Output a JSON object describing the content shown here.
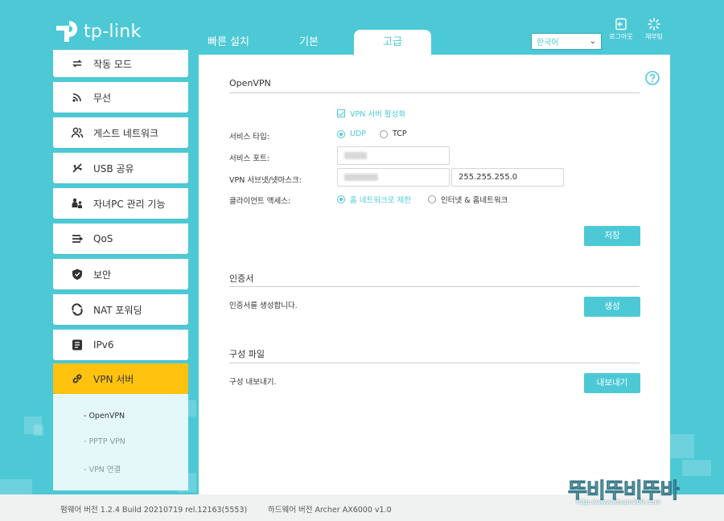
{
  "brand": {
    "name": "tp-link"
  },
  "tabs": [
    {
      "label": "빠른 설치"
    },
    {
      "label": "기본"
    },
    {
      "label": "고급"
    }
  ],
  "header": {
    "language": "한국어",
    "logout_label": "로그아웃",
    "reboot_label": "재부팅"
  },
  "sidebar": {
    "items": [
      {
        "label": "작동 모드",
        "icon": "operation-mode-icon"
      },
      {
        "label": "무선",
        "icon": "wireless-icon"
      },
      {
        "label": "게스트 네트워크",
        "icon": "guest-network-icon"
      },
      {
        "label": "USB 공유",
        "icon": "usb-icon"
      },
      {
        "label": "자녀PC 관리 기능",
        "icon": "parental-controls-icon"
      },
      {
        "label": "QoS",
        "icon": "qos-icon"
      },
      {
        "label": "보안",
        "icon": "shield-icon"
      },
      {
        "label": "NAT 포워딩",
        "icon": "nat-forwarding-icon"
      },
      {
        "label": "IPv6",
        "icon": "ipv6-icon"
      },
      {
        "label": "VPN 서버",
        "icon": "link-icon"
      }
    ],
    "submenu": [
      {
        "label": "- OpenVPN"
      },
      {
        "label": "- PPTP VPN"
      },
      {
        "label": "- VPN 연결"
      }
    ]
  },
  "openvpn": {
    "title": "OpenVPN",
    "enable_label": "VPN 서버 활성화",
    "enable_checked": true,
    "service_type_label": "서비스 타입:",
    "udp_label": "UDP",
    "tcp_label": "TCP",
    "service_type_selected": "UDP",
    "port_label": "서비스 포트:",
    "subnet_label": "VPN 서브넷/넷마스크:",
    "netmask_value": "255.255.255.0",
    "client_access_label": "클라이언트 액세스:",
    "home_network_label": "홈 네트워크로 제한",
    "internet_home_label": "인터넷 & 홈네트워크",
    "client_access_selected": "홈 네트워크로 제한",
    "save_label": "저장"
  },
  "certificate": {
    "title": "인증서",
    "description": "인증서를 생성합니다.",
    "generate_label": "생성"
  },
  "config_file": {
    "title": "구성 파일",
    "description": "구성 내보내기.",
    "export_label": "내보내기"
  },
  "footer": {
    "firmware": "펌웨어 버전 1.2.4 Build 20210719 rel.12163(5553)",
    "hardware": "하드웨어 버전 Archer AX6000 v1.0"
  },
  "colors": {
    "accent": "#4dc9d6",
    "active_menu": "#ffc20e"
  }
}
